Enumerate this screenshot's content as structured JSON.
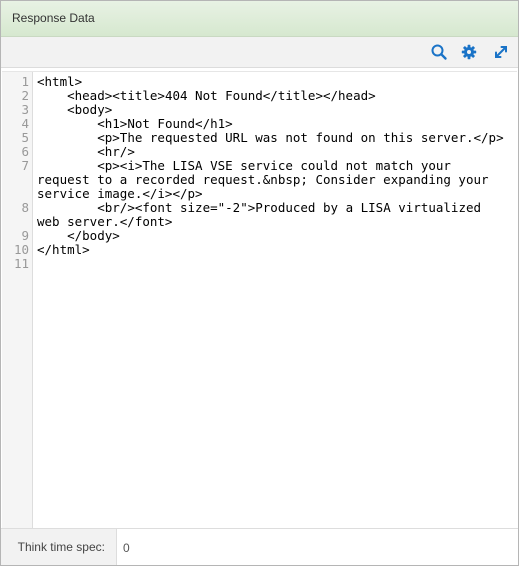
{
  "panel": {
    "title": "Response Data"
  },
  "toolbar": {
    "icons": [
      "search-icon",
      "gear-icon",
      "expand-icon"
    ],
    "accent_color": "#1a73c7"
  },
  "editor": {
    "lines": [
      {
        "number": "1",
        "text": "<html>"
      },
      {
        "number": "2",
        "text": "    <head><title>404 Not Found</title></head>"
      },
      {
        "number": "3",
        "text": "    <body>"
      },
      {
        "number": "4",
        "text": "        <h1>Not Found</h1>"
      },
      {
        "number": "5",
        "text": "        <p>The requested URL was not found on this server.</p>"
      },
      {
        "number": "6",
        "text": "        <hr/>"
      },
      {
        "number": "7",
        "text": "        <p><i>The LISA VSE service could not match your request to a recorded request.&nbsp; Consider expanding your service image.</i></p>"
      },
      {
        "number": "8",
        "text": "        <br/><font size=\"-2\">Produced by a LISA virtualized web server.</font>"
      },
      {
        "number": "9",
        "text": "    </body>"
      },
      {
        "number": "10",
        "text": "</html>"
      },
      {
        "number": "11",
        "text": ""
      }
    ]
  },
  "footer": {
    "think_time_label": "Think time spec:",
    "think_time_value": "0"
  }
}
